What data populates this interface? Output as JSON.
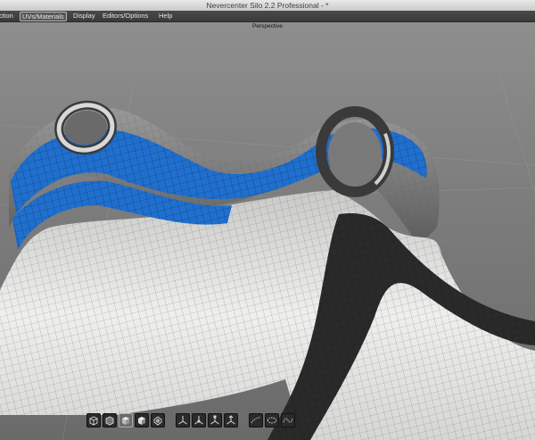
{
  "window": {
    "title": "Nevercenter Silo 2.2 Professional - *"
  },
  "menu": {
    "items": [
      {
        "label": "ction"
      },
      {
        "label": "UVs/Materials",
        "active": true
      },
      {
        "label": "Display"
      },
      {
        "label": "Editors/Options"
      },
      {
        "label": "Help"
      }
    ]
  },
  "viewport": {
    "label": "Perspective",
    "colors": {
      "uv_band": "#1f6fcf",
      "mesh_light": "#ececea",
      "mesh_dark": "#2a2a2a"
    }
  },
  "toolbar": {
    "groups": [
      {
        "name": "display-modes",
        "buttons": [
          "wireframe-icon",
          "wireframe-shaded-icon",
          "shaded-icon",
          "shaded-lit-icon",
          "subdivision-cage-icon"
        ]
      },
      {
        "name": "manipulators",
        "buttons": [
          "move-manipulator-icon",
          "rotate-manipulator-icon",
          "scale-manipulator-icon",
          "universal-manipulator-icon"
        ]
      },
      {
        "name": "selection-modes",
        "buttons": [
          "edge-loop-icon",
          "edge-ring-icon",
          "paint-select-icon"
        ]
      }
    ]
  }
}
